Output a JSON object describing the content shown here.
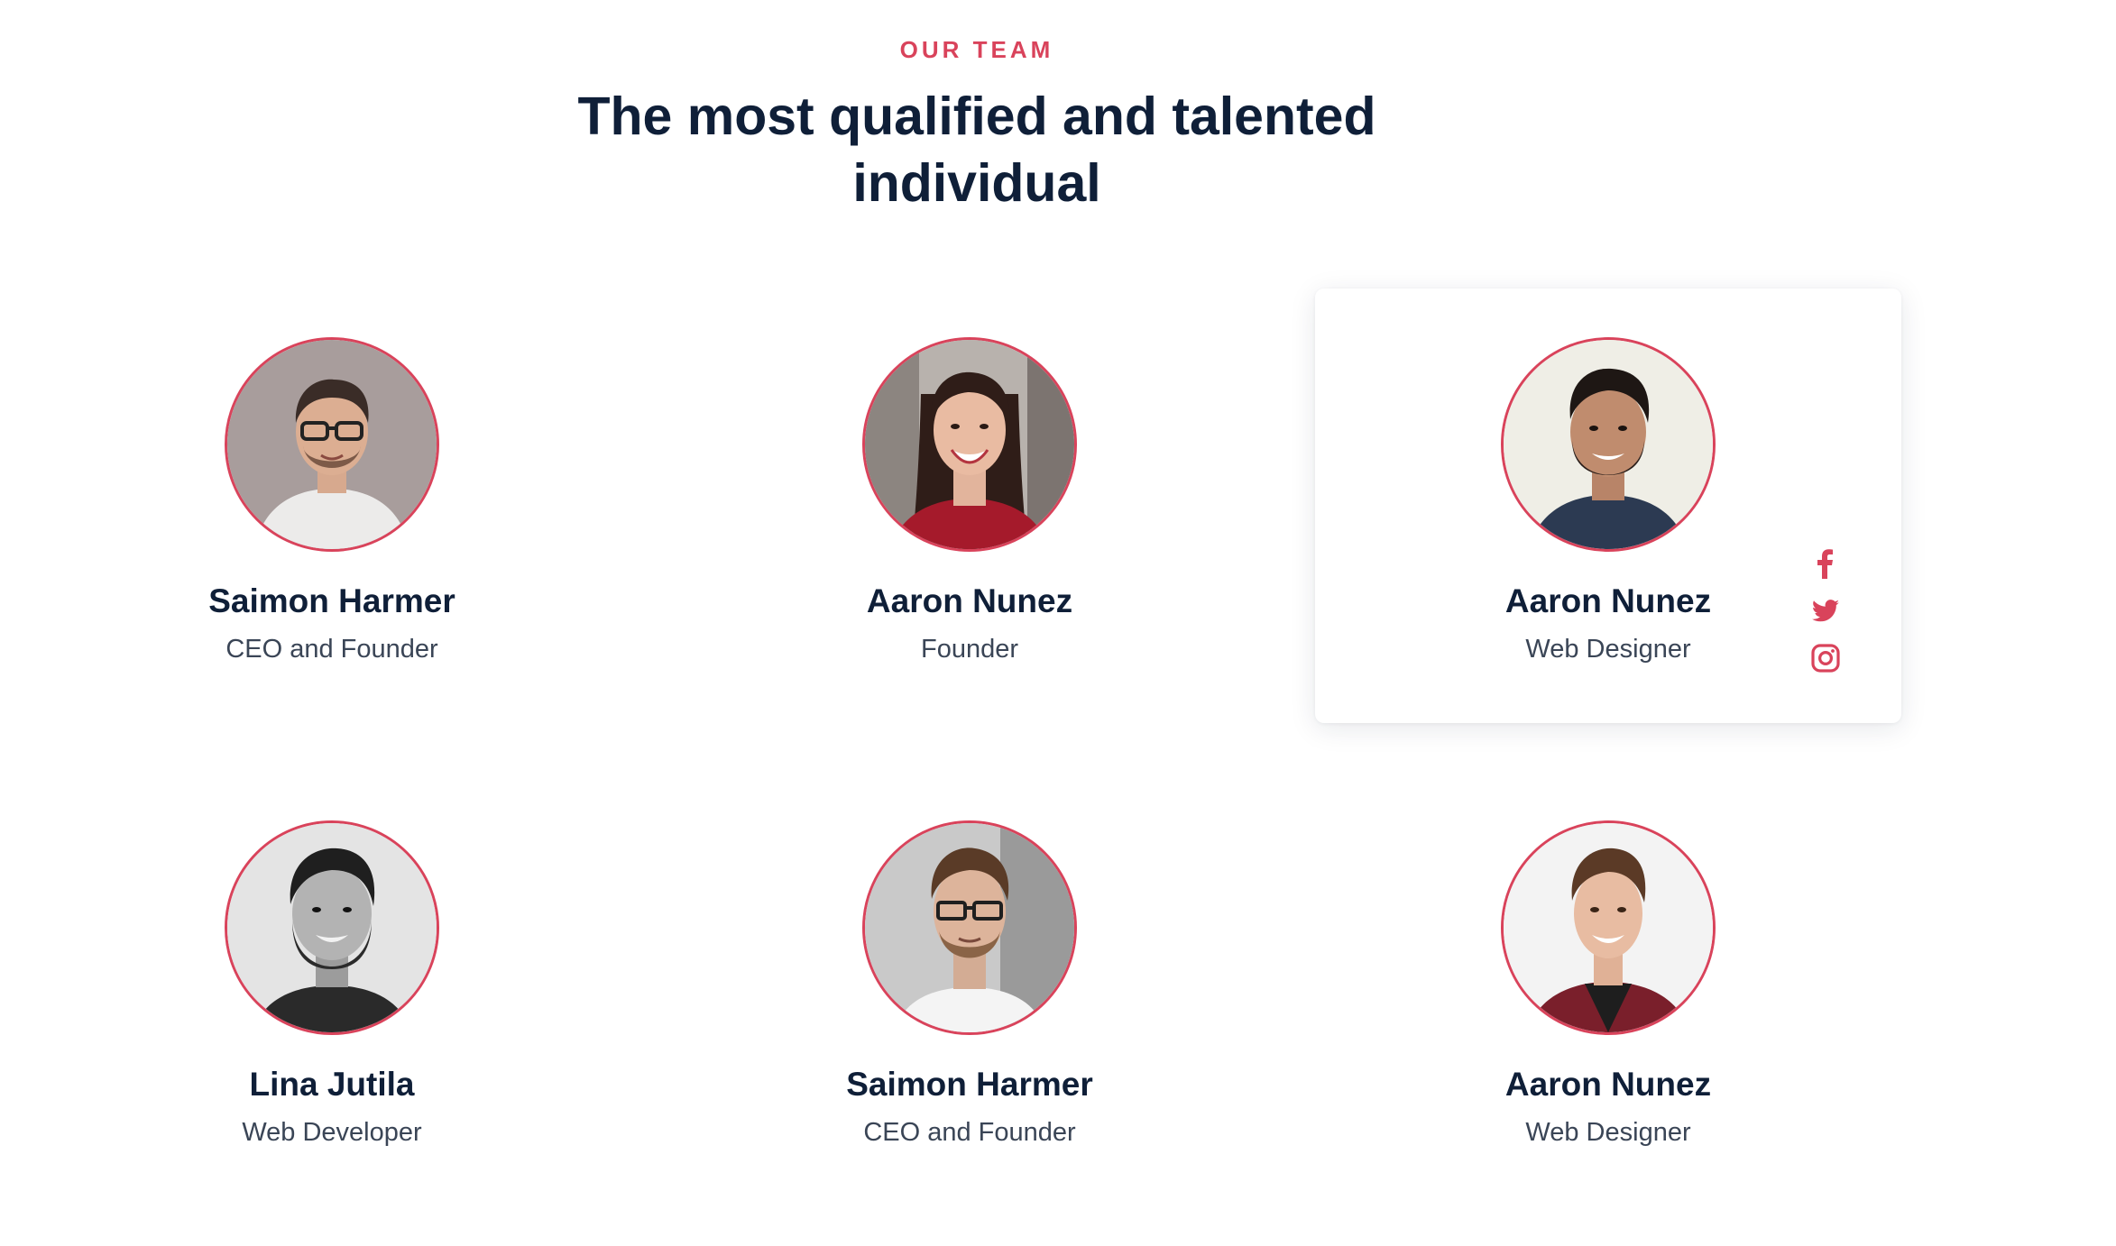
{
  "section": {
    "eyebrow": "OUR TEAM",
    "heading": "The most qualified and talented individual"
  },
  "colors": {
    "accent": "#d9435b",
    "heading": "#0f1f38",
    "body": "#3a4556"
  },
  "team": [
    {
      "name": "Saimon Harmer",
      "role": "CEO and Founder",
      "photo": "man-glasses-gray-tshirt"
    },
    {
      "name": "Aaron Nunez",
      "role": "Founder",
      "photo": "woman-red-sweater"
    },
    {
      "name": "Aaron Nunez",
      "role": "Web Designer",
      "photo": "man-beard-navy-sweater"
    },
    {
      "name": "Lina Jutila",
      "role": "Web Developer",
      "photo": "man-beard-black-and-white"
    },
    {
      "name": "Saimon Harmer",
      "role": "CEO and Founder",
      "photo": "man-glasses-white-tshirt"
    },
    {
      "name": "Aaron Nunez",
      "role": "Web Designer",
      "photo": "young-man-plaid-shirt"
    }
  ],
  "social_icons": [
    "facebook-icon",
    "twitter-icon",
    "instagram-icon"
  ]
}
